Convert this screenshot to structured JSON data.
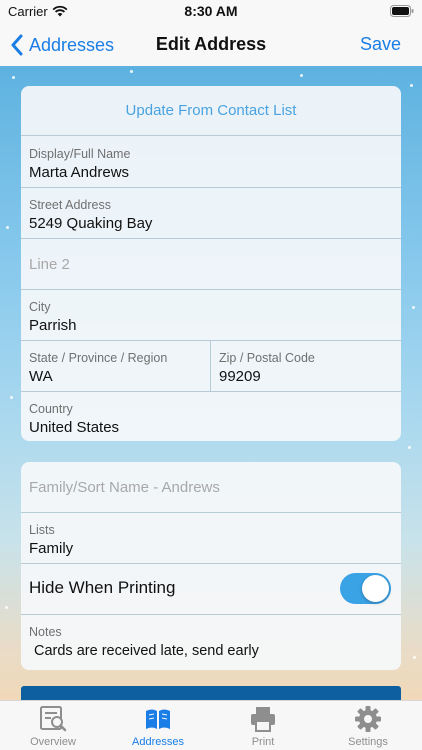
{
  "status_bar": {
    "carrier": "Carrier",
    "time": "8:30 AM"
  },
  "nav": {
    "back_label": "Addresses",
    "title": "Edit Address",
    "save_label": "Save"
  },
  "address_card": {
    "update_link": "Update From Contact List",
    "display_name": {
      "label": "Display/Full Name",
      "value": "Marta Andrews"
    },
    "street": {
      "label": "Street Address",
      "value": "5249 Quaking Bay"
    },
    "line2": {
      "placeholder": "Line 2"
    },
    "city": {
      "label": "City",
      "value": "Parrish"
    },
    "state": {
      "label": "State / Province / Region",
      "value": "WA"
    },
    "zip": {
      "label": "Zip / Postal Code",
      "value": "99209"
    },
    "country": {
      "label": "Country",
      "value": "United States"
    }
  },
  "details_card": {
    "family_name_placeholder": "Family/Sort Name - Andrews",
    "lists": {
      "label": "Lists",
      "value": "Family"
    },
    "hide_when_printing": {
      "label": "Hide When Printing",
      "on": true
    },
    "notes": {
      "label": "Notes",
      "value": "Cards are received late, send early"
    }
  },
  "tab_bar": {
    "tabs": [
      {
        "label": "Overview",
        "icon": "overview-icon",
        "active": false
      },
      {
        "label": "Addresses",
        "icon": "book-icon",
        "active": true
      },
      {
        "label": "Print",
        "icon": "printer-icon",
        "active": false
      },
      {
        "label": "Settings",
        "icon": "gear-icon",
        "active": false
      }
    ]
  },
  "colors": {
    "accent": "#1a7ee6",
    "toggle_on": "#3aa3e6",
    "link": "#4aa3e0",
    "strip": "#0d5fa0"
  }
}
